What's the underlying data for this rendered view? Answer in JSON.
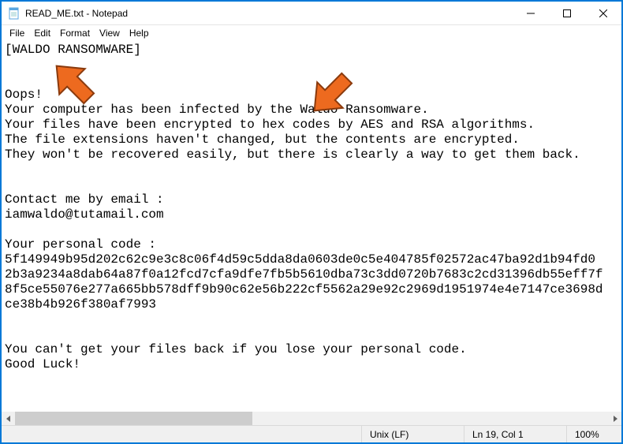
{
  "window": {
    "title": "READ_ME.txt - Notepad"
  },
  "menu": {
    "file": "File",
    "edit": "Edit",
    "format": "Format",
    "view": "View",
    "help": "Help"
  },
  "content": {
    "header": "[WALDO RANSOMWARE]",
    "blank1": "",
    "blank2": "",
    "oops": "Oops!",
    "line1": "Your computer has been infected by the Waldo Ransomware.",
    "line2": "Your files have been encrypted to hex codes by AES and RSA algorithms.",
    "line3": "The file extensions haven't changed, but the contents are encrypted.",
    "line4": "They won't be recovered easily, but there is clearly a way to get them back.",
    "blank3": "",
    "blank4": "",
    "contact_label": "Contact me by email :",
    "contact_email": "iamwaldo@tutamail.com",
    "blank5": "",
    "code_label": "Your personal code :",
    "code_l1": "5f149949b95d202c62c9e3c8c06f4d59c5dda8da0603de0c5e404785f02572ac47ba92d1b94fd0",
    "code_l2": "2b3a9234a8dab64a87f0a12fcd7cfa9dfe7fb5b5610dba73c3dd0720b7683c2cd31396db55eff7f",
    "code_l3": "8f5ce55076e277a665bb578dff9b90c62e56b222cf5562a29e92c2969d1951974e4e7147ce3698d",
    "code_l4": "ce38b4b926f380af7993",
    "blank6": "",
    "blank7": "",
    "warn": "You can't get your files back if you lose your personal code.",
    "luck": "Good Luck!"
  },
  "status": {
    "eol": "Unix (LF)",
    "pos": "Ln 19, Col 1",
    "zoom": "100%"
  },
  "colors": {
    "arrow": "#ed6a1f",
    "arrow_stroke": "#8a3a0d",
    "frame": "#0078d7"
  }
}
